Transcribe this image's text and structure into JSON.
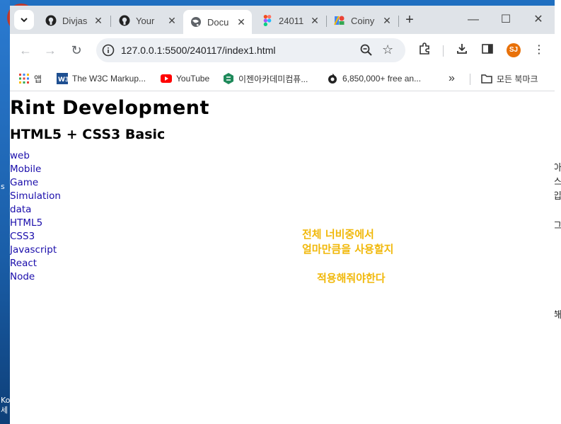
{
  "desktop": {
    "left_fragments": [
      "s",
      "Ko",
      "세"
    ],
    "right_fragments": [
      "아",
      "스",
      "입",
      "그",
      "해"
    ]
  },
  "browser": {
    "tabs": [
      {
        "title": "Divjas",
        "icon": "github-icon"
      },
      {
        "title": "Your",
        "icon": "github-icon"
      },
      {
        "title": "Docu",
        "icon": "globe-icon",
        "active": true
      },
      {
        "title": "24011",
        "icon": "figma-icon"
      },
      {
        "title": "Coiny",
        "icon": "google-fonts-icon"
      }
    ],
    "new_tab": "+",
    "window_controls": {
      "minimize": "—",
      "maximize": "☐",
      "close": "✕"
    },
    "toolbar": {
      "back": "←",
      "forward": "→",
      "reload": "↻",
      "url": "127.0.0.1:5500/240117/index1.html",
      "profile_initials": "SJ",
      "menu": "⋮"
    },
    "bookmarks": [
      {
        "label": "앱",
        "icon": "apps-grid-icon"
      },
      {
        "label": "The W3C Markup...",
        "icon": "w3c-icon"
      },
      {
        "label": "YouTube",
        "icon": "youtube-icon"
      },
      {
        "label": "이젠아카데미컴퓨...",
        "icon": "ezen-icon"
      },
      {
        "label": "6,850,000+ free an...",
        "icon": "freepik-icon"
      }
    ],
    "bookmarks_overflow": "»",
    "all_bookmarks": "모든 북마크"
  },
  "page": {
    "title": "Rint Development",
    "subtitle": "HTML5 + CSS3 Basic",
    "nav": [
      "web",
      "Mobile",
      "Game",
      "Simulation",
      "data",
      "HTML5",
      "CSS3",
      "Javascript",
      "React",
      "Node"
    ],
    "note_lines": [
      "전체 너비중에서",
      "얼마만큼을 사용할지"
    ],
    "note_line3": "적용해줘야한다"
  },
  "colors": {
    "tabstrip_bg": "#dfe3e8",
    "link": "#1a0dab",
    "note": "#f1b80a",
    "profile": "#e8710a"
  }
}
